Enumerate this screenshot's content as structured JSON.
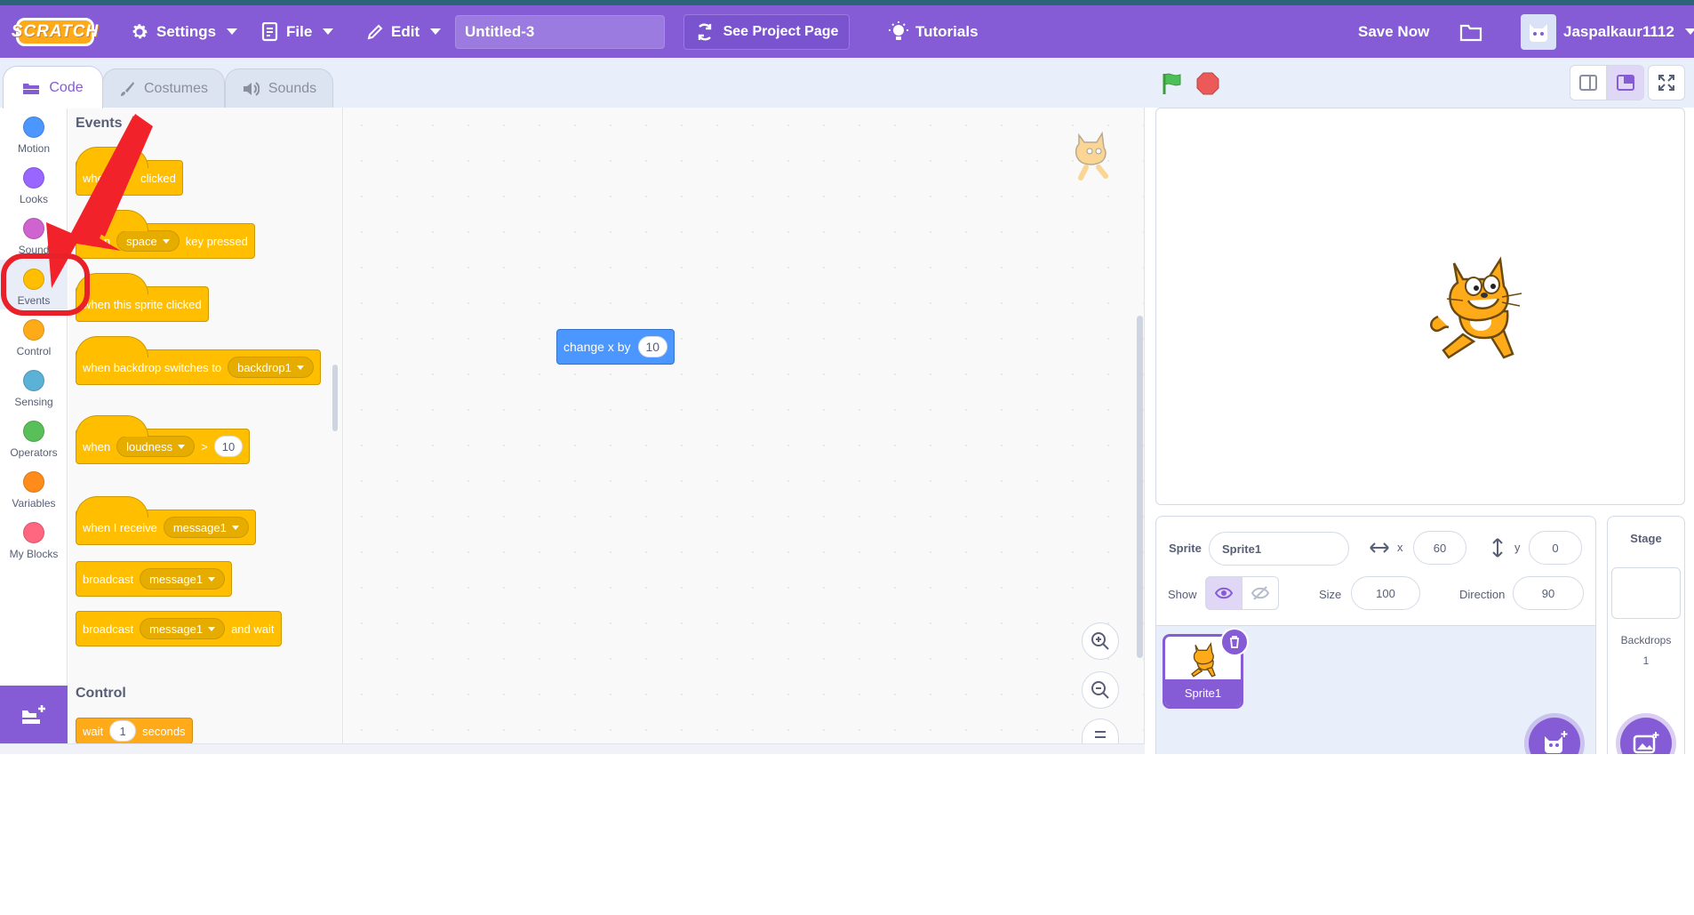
{
  "menubar": {
    "logo": "SCRATCH",
    "settings": "Settings",
    "file": "File",
    "edit": "Edit",
    "project_title": "Untitled-3",
    "see_project_page": "See Project Page",
    "tutorials": "Tutorials",
    "save_now": "Save Now",
    "username": "Jaspalkaur1112"
  },
  "tabs": {
    "code": "Code",
    "costumes": "Costumes",
    "sounds": "Sounds"
  },
  "categories": [
    {
      "label": "Motion",
      "color": "#4c97ff"
    },
    {
      "label": "Looks",
      "color": "#9966ff"
    },
    {
      "label": "Sound",
      "color": "#cf63cf"
    },
    {
      "label": "Events",
      "color": "#ffbf00"
    },
    {
      "label": "Control",
      "color": "#ffab19"
    },
    {
      "label": "Sensing",
      "color": "#5cb1d6"
    },
    {
      "label": "Operators",
      "color": "#59c059"
    },
    {
      "label": "Variables",
      "color": "#ff8c1a"
    },
    {
      "label": "My Blocks",
      "color": "#ff6680"
    }
  ],
  "palette": {
    "events_title": "Events",
    "b1": {
      "pre": "when",
      "post": "clicked"
    },
    "b2": {
      "pre": "when",
      "dropdown": "space",
      "post": "key pressed"
    },
    "b3": {
      "text": "when this sprite clicked"
    },
    "b4": {
      "pre": "when backdrop switches to",
      "dropdown": "backdrop1"
    },
    "b5": {
      "pre": "when",
      "dropdown": "loudness",
      "op": ">",
      "value": "10"
    },
    "b6": {
      "pre": "when I receive",
      "dropdown": "message1"
    },
    "b7": {
      "pre": "broadcast",
      "dropdown": "message1"
    },
    "b8": {
      "pre": "broadcast",
      "dropdown": "message1",
      "post": "and wait"
    },
    "control_title": "Control",
    "b9": {
      "pre": "wait",
      "value": "1",
      "post": "seconds"
    }
  },
  "workspace": {
    "block": {
      "text": "change x by",
      "value": "10"
    }
  },
  "sprite_info": {
    "sprite_label": "Sprite",
    "sprite_name": "Sprite1",
    "x_label": "x",
    "x_value": "60",
    "y_label": "y",
    "y_value": "0",
    "show_label": "Show",
    "size_label": "Size",
    "size_value": "100",
    "direction_label": "Direction",
    "direction_value": "90"
  },
  "sprite_list": {
    "sprites": [
      {
        "name": "Sprite1"
      }
    ]
  },
  "stage_panel": {
    "title": "Stage",
    "backdrops_label": "Backdrops",
    "backdrops_count": "1"
  },
  "annotations": {
    "arrow_color": "#f2222a",
    "circle_color": "#e8202a"
  }
}
